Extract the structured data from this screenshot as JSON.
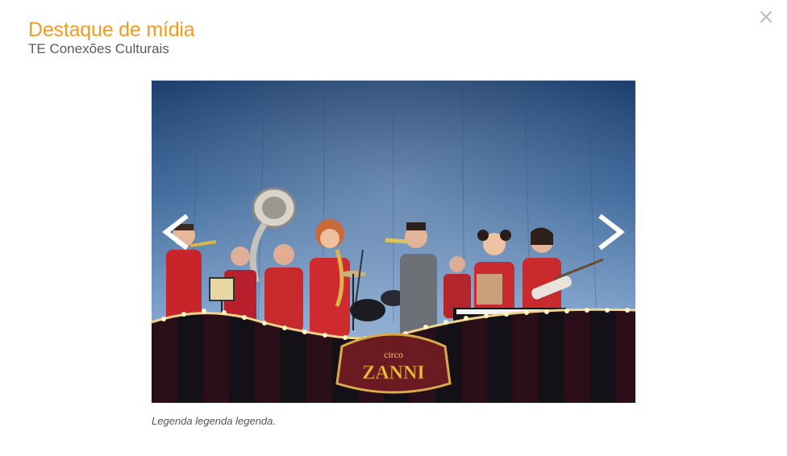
{
  "header": {
    "title": "Destaque de mídia",
    "subtitle": "TE Conexões Culturais"
  },
  "close_button": {
    "icon": "close-icon"
  },
  "media": {
    "sign_line1": "circo",
    "sign_line2": "ZANNI",
    "prev_icon": "chevron-left-icon",
    "next_icon": "chevron-right-icon"
  },
  "caption": "Legenda legenda legenda.",
  "colors": {
    "accent": "#f39a1f",
    "subtitle": "#5a5a5a",
    "close": "#bbbbbb",
    "caption": "#555555"
  }
}
